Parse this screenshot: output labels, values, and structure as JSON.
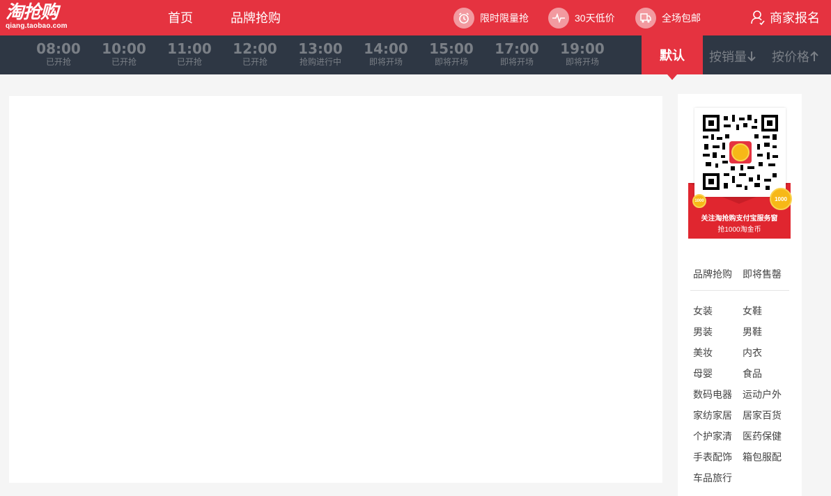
{
  "header": {
    "logo_main": "淘抢购",
    "logo_sub": "qiang.taobao.com",
    "nav": [
      "首页",
      "品牌抢购"
    ],
    "features": [
      {
        "label": "限时限量抢",
        "icon": "alarm-clock-icon"
      },
      {
        "label": "30天低价",
        "icon": "pulse-line-icon"
      },
      {
        "label": "全场包邮",
        "icon": "delivery-truck-icon"
      }
    ],
    "merchant": "商家报名"
  },
  "timeslots": [
    {
      "time": "08:00",
      "status": "已开抢"
    },
    {
      "time": "10:00",
      "status": "已开抢"
    },
    {
      "time": "11:00",
      "status": "已开抢"
    },
    {
      "time": "12:00",
      "status": "已开抢"
    },
    {
      "time": "13:00",
      "status": "抢购进行中"
    },
    {
      "time": "14:00",
      "status": "即将开场"
    },
    {
      "time": "15:00",
      "status": "即将开场"
    },
    {
      "time": "17:00",
      "status": "即将开场"
    },
    {
      "time": "19:00",
      "status": "即将开场"
    }
  ],
  "sort": {
    "default": "默认",
    "by_sales": "按销量",
    "by_price": "按价格"
  },
  "promo": {
    "line1": "关注淘抢购支付宝服务窗",
    "line2": "抢1000淘金币",
    "coin_text": "1000"
  },
  "colors": {
    "brand_red": "#e53340",
    "timebar_bg": "#2e3744",
    "muted_text": "#7a7f86"
  },
  "sidebar": {
    "top_links": [
      "品牌抢购",
      "即将售罄"
    ],
    "categories": [
      [
        "女装",
        "女鞋"
      ],
      [
        "男装",
        "男鞋"
      ],
      [
        "美妆",
        "内衣"
      ],
      [
        "母婴",
        "食品"
      ],
      [
        "数码电器",
        "运动户外"
      ],
      [
        "家纺家居",
        "居家百货"
      ],
      [
        "个护家清",
        "医药保健"
      ],
      [
        "手表配饰",
        "箱包服配"
      ],
      [
        "车品旅行",
        ""
      ]
    ]
  }
}
